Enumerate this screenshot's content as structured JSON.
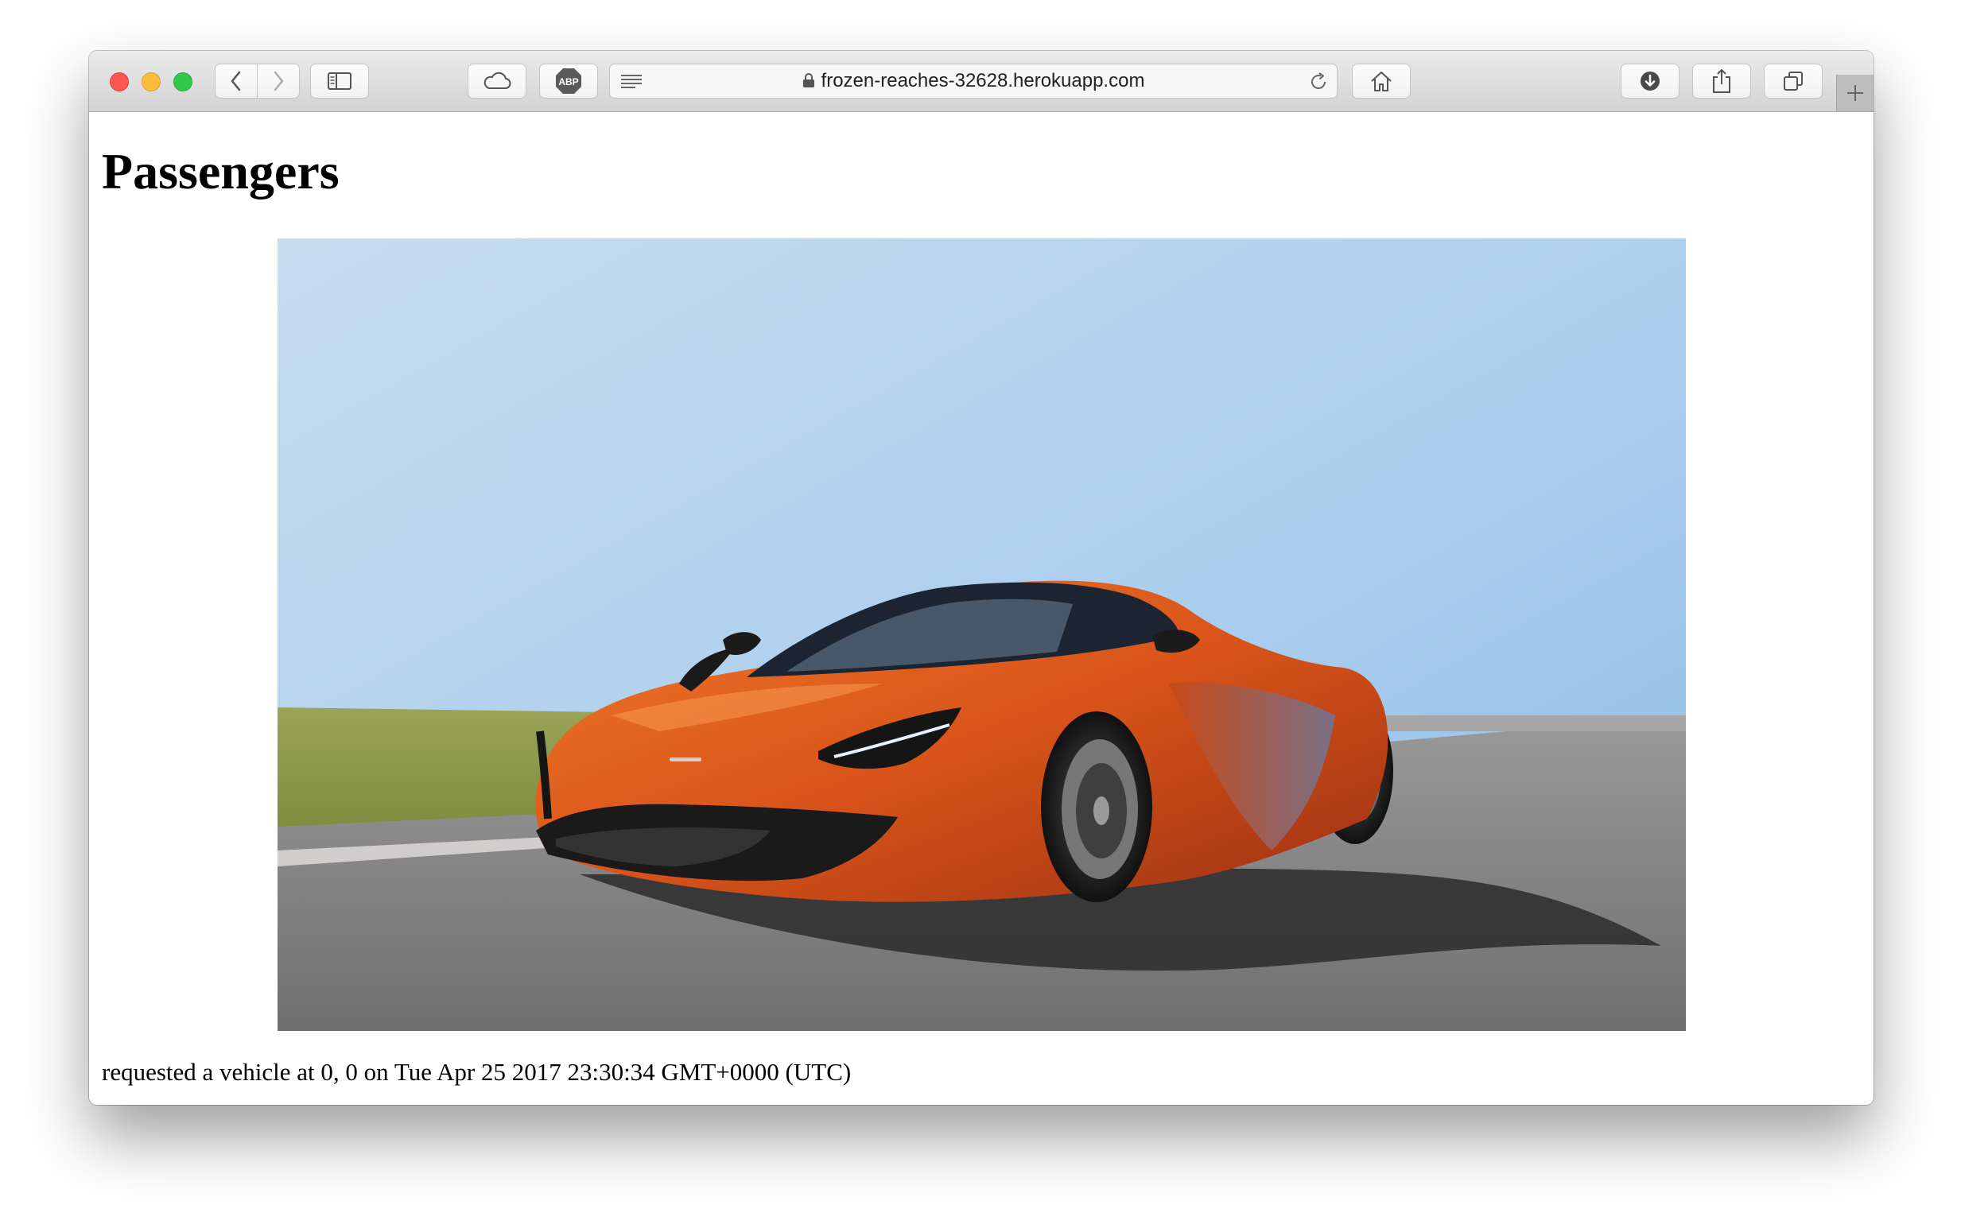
{
  "browser": {
    "url": "frozen-reaches-32628.herokuapp.com",
    "toolbar_icons": [
      "back-icon",
      "forward-icon",
      "sidebar-icon",
      "icloud-icon",
      "adblock-icon",
      "reader-icon",
      "lock-icon",
      "reload-icon",
      "home-icon",
      "download-icon",
      "share-icon",
      "tabs-icon",
      "new-tab-icon"
    ],
    "adblock_label": "ABP"
  },
  "page": {
    "heading": "Passengers",
    "image_subject": "orange-sports-car",
    "request_text": "requested a vehicle at 0, 0 on Tue Apr 25 2017 23:30:34 GMT+0000 (UTC)"
  },
  "colors": {
    "car": "#e0531c",
    "sky": "#a9cdee",
    "close": "#fc5753",
    "minimize": "#fdbc40",
    "maximize": "#34c84a"
  }
}
